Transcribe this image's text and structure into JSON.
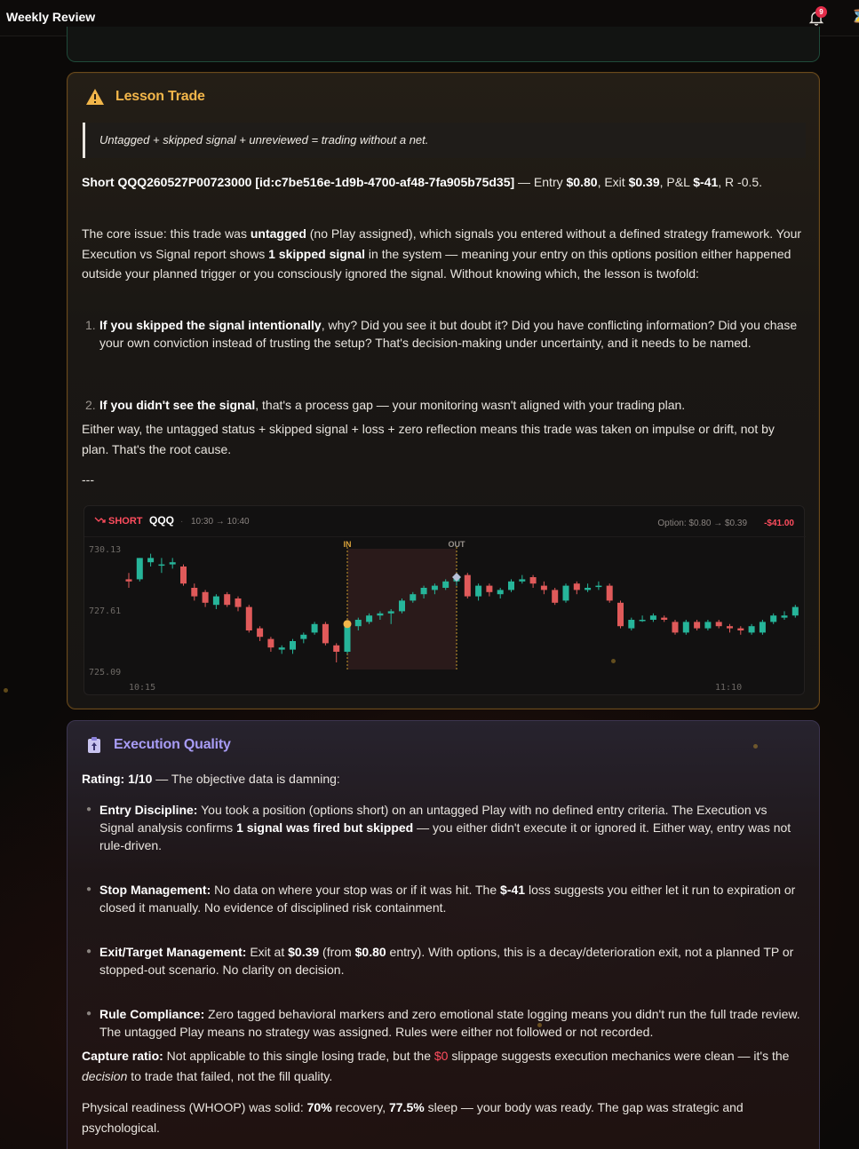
{
  "app": {
    "title": "Weekly Review",
    "notification_count": "9"
  },
  "lesson": {
    "title": "Lesson Trade",
    "quote": "Untagged + skipped signal + unreviewed = trading without a net.",
    "trade": {
      "label": "Short QQQ260527P00723000 [id:c7be516e-1d9b-4700-af48-7fa905b75d35]",
      "entry_prefix": " — Entry ",
      "entry": "$0.80",
      "exit_prefix": ", Exit ",
      "exit": "$0.39",
      "pnl_prefix": ", P&L ",
      "pnl": "$-41",
      "r_text": ", R -0.5."
    },
    "core_issue": {
      "t1": "The core issue: this trade was ",
      "b1": "untagged",
      "t2": " (no Play assigned), which signals you entered without a defined strategy framework. Your Execution vs Signal report shows ",
      "b2": "1 skipped signal",
      "t3": " in the system — meaning your entry on this options position either happened outside your planned trigger or you consciously ignored the signal. Without knowing which, the lesson is twofold:"
    },
    "items": [
      {
        "num": "1.",
        "bold": "If you skipped the signal intentionally",
        "text": ", why? Did you see it but doubt it? Did you have conflicting information? Did you chase your own conviction instead of trusting the setup? That's decision-making under uncertainty, and it needs to be named."
      },
      {
        "num": "2.",
        "bold": "If you didn't see the signal",
        "text": ", that's a process gap — your monitoring wasn't aligned with your trading plan."
      }
    ],
    "conclusion": "Either way, the untagged status + skipped signal + loss + zero reflection means this trade was taken on impulse or drift, not by plan. That's the root cause.",
    "separator": "---"
  },
  "chart_data": {
    "type": "candlestick",
    "direction": "SHORT",
    "symbol": "QQQ",
    "time_range": "10:30 → 10:40",
    "option_text": "Option: $0.80 → $0.39",
    "pnl_text": "-$41.00",
    "y_ticks": [
      "730.13",
      "727.61",
      "725.09"
    ],
    "ylim": [
      724.6,
      730.6
    ],
    "x_start_label": "10:15",
    "x_end_label": "11:10",
    "entry_label": "IN",
    "exit_label": "OUT",
    "entry_index": 20,
    "exit_index": 30,
    "candles": [
      {
        "o": 729.0,
        "c": 728.9,
        "h": 729.3,
        "l": 728.6
      },
      {
        "o": 729.0,
        "c": 730.0,
        "h": 730.0,
        "l": 728.9
      },
      {
        "o": 729.8,
        "c": 730.0,
        "h": 730.2,
        "l": 729.6
      },
      {
        "o": 729.7,
        "c": 729.7,
        "h": 730.0,
        "l": 729.3
      },
      {
        "o": 729.7,
        "c": 729.8,
        "h": 730.0,
        "l": 729.5
      },
      {
        "o": 729.6,
        "c": 728.8,
        "h": 729.7,
        "l": 728.7
      },
      {
        "o": 728.6,
        "c": 728.2,
        "h": 728.8,
        "l": 728.0
      },
      {
        "o": 728.4,
        "c": 727.9,
        "h": 728.5,
        "l": 727.7
      },
      {
        "o": 727.8,
        "c": 728.2,
        "h": 728.3,
        "l": 727.6
      },
      {
        "o": 728.3,
        "c": 727.8,
        "h": 728.4,
        "l": 727.7
      },
      {
        "o": 728.1,
        "c": 727.7,
        "h": 728.2,
        "l": 727.5
      },
      {
        "o": 727.7,
        "c": 726.6,
        "h": 727.8,
        "l": 726.5
      },
      {
        "o": 726.7,
        "c": 726.3,
        "h": 726.8,
        "l": 726.1
      },
      {
        "o": 726.2,
        "c": 725.8,
        "h": 726.3,
        "l": 725.6
      },
      {
        "o": 725.7,
        "c": 725.8,
        "h": 725.9,
        "l": 725.5
      },
      {
        "o": 725.7,
        "c": 726.1,
        "h": 726.2,
        "l": 725.5
      },
      {
        "o": 726.2,
        "c": 726.4,
        "h": 726.5,
        "l": 726.0
      },
      {
        "o": 726.5,
        "c": 726.9,
        "h": 727.0,
        "l": 726.4
      },
      {
        "o": 726.9,
        "c": 726.0,
        "h": 727.0,
        "l": 725.9
      },
      {
        "o": 725.9,
        "c": 725.6,
        "h": 726.0,
        "l": 725.1
      },
      {
        "o": 725.6,
        "c": 726.9,
        "h": 727.0,
        "l": 725.5
      },
      {
        "o": 726.8,
        "c": 727.1,
        "h": 727.2,
        "l": 726.6
      },
      {
        "o": 727.0,
        "c": 727.3,
        "h": 727.4,
        "l": 726.9
      },
      {
        "o": 727.3,
        "c": 727.4,
        "h": 727.5,
        "l": 727.1
      },
      {
        "o": 727.4,
        "c": 727.5,
        "h": 727.6,
        "l": 726.9
      },
      {
        "o": 727.5,
        "c": 728.0,
        "h": 728.1,
        "l": 727.4
      },
      {
        "o": 728.0,
        "c": 728.3,
        "h": 728.4,
        "l": 727.9
      },
      {
        "o": 728.3,
        "c": 728.6,
        "h": 728.7,
        "l": 728.1
      },
      {
        "o": 728.5,
        "c": 728.7,
        "h": 728.8,
        "l": 728.3
      },
      {
        "o": 728.6,
        "c": 728.9,
        "h": 729.0,
        "l": 728.5
      },
      {
        "o": 728.9,
        "c": 729.1,
        "h": 729.3,
        "l": 728.7
      },
      {
        "o": 729.2,
        "c": 728.2,
        "h": 729.3,
        "l": 728.1
      },
      {
        "o": 728.2,
        "c": 728.7,
        "h": 728.8,
        "l": 728.0
      },
      {
        "o": 728.7,
        "c": 728.4,
        "h": 728.8,
        "l": 728.2
      },
      {
        "o": 728.3,
        "c": 728.5,
        "h": 728.6,
        "l": 728.1
      },
      {
        "o": 728.5,
        "c": 728.9,
        "h": 729.0,
        "l": 728.4
      },
      {
        "o": 728.9,
        "c": 729.0,
        "h": 729.2,
        "l": 728.8
      },
      {
        "o": 729.1,
        "c": 728.8,
        "h": 729.2,
        "l": 728.6
      },
      {
        "o": 728.7,
        "c": 728.5,
        "h": 728.9,
        "l": 728.3
      },
      {
        "o": 728.5,
        "c": 727.9,
        "h": 728.6,
        "l": 727.8
      },
      {
        "o": 728.0,
        "c": 728.7,
        "h": 728.8,
        "l": 727.9
      },
      {
        "o": 728.8,
        "c": 728.5,
        "h": 728.9,
        "l": 728.3
      },
      {
        "o": 728.5,
        "c": 728.6,
        "h": 728.8,
        "l": 728.4
      },
      {
        "o": 728.7,
        "c": 728.7,
        "h": 728.9,
        "l": 728.5
      },
      {
        "o": 728.7,
        "c": 728.0,
        "h": 728.8,
        "l": 727.9
      },
      {
        "o": 727.9,
        "c": 726.8,
        "h": 728.0,
        "l": 726.7
      },
      {
        "o": 726.7,
        "c": 727.1,
        "h": 727.2,
        "l": 726.6
      },
      {
        "o": 727.1,
        "c": 727.1,
        "h": 727.3,
        "l": 727.0
      },
      {
        "o": 727.1,
        "c": 727.3,
        "h": 727.4,
        "l": 727.0
      },
      {
        "o": 727.2,
        "c": 727.1,
        "h": 727.3,
        "l": 727.0
      },
      {
        "o": 727.0,
        "c": 726.5,
        "h": 727.1,
        "l": 726.4
      },
      {
        "o": 726.5,
        "c": 727.0,
        "h": 727.1,
        "l": 726.4
      },
      {
        "o": 727.0,
        "c": 726.7,
        "h": 727.1,
        "l": 726.6
      },
      {
        "o": 726.7,
        "c": 727.0,
        "h": 727.1,
        "l": 726.6
      },
      {
        "o": 727.0,
        "c": 726.8,
        "h": 727.1,
        "l": 726.7
      },
      {
        "o": 726.8,
        "c": 726.7,
        "h": 726.9,
        "l": 726.5
      },
      {
        "o": 726.7,
        "c": 726.6,
        "h": 726.8,
        "l": 726.4
      },
      {
        "o": 726.5,
        "c": 726.8,
        "h": 726.9,
        "l": 726.4
      },
      {
        "o": 726.5,
        "c": 727.0,
        "h": 727.1,
        "l": 726.4
      },
      {
        "o": 727.0,
        "c": 727.3,
        "h": 727.4,
        "l": 726.9
      },
      {
        "o": 727.2,
        "c": 727.3,
        "h": 727.5,
        "l": 727.1
      },
      {
        "o": 727.3,
        "c": 727.7,
        "h": 727.8,
        "l": 727.2
      }
    ]
  },
  "execution": {
    "title": "Execution Quality",
    "rating_label": "Rating: 1/10",
    "rating_text": " — The objective data is damning:",
    "items": [
      {
        "bold": "Entry Discipline:",
        "t1": " You took a position (options short) on an untagged Play with no defined entry criteria. The Execution vs Signal analysis confirms ",
        "b2": "1 signal was fired but skipped",
        "t2": " — you either didn't execute it or ignored it. Either way, entry was not rule-driven."
      },
      {
        "bold": "Stop Management:",
        "t1": " No data on where your stop was or if it was hit. The ",
        "b2": "$-41",
        "t2": " loss suggests you either let it run to expiration or closed it manually. No evidence of disciplined risk containment."
      },
      {
        "bold": "Exit/Target Management:",
        "t1": " Exit at ",
        "b2": "$0.39",
        "t2": " (from ",
        "b3": "$0.80",
        "t3": " entry). With options, this is a decay/deterioration exit, not a planned TP or stopped-out scenario. No clarity on decision."
      },
      {
        "bold": "Rule Compliance:",
        "t1": " Zero tagged behavioral markers and zero emotional state logging means you didn't run the full trade review. The untagged Play means no strategy was assigned. Rules were either not followed or not recorded."
      }
    ],
    "capture": {
      "label": "Capture ratio:",
      "t1": " Not applicable to this single losing trade, but the ",
      "red": "$0",
      "t2": " slippage suggests execution mechanics were clean — it's the ",
      "em": "decision",
      "t3": " to trade that failed, not the fill quality."
    },
    "physical": {
      "t1": "Physical readiness (WHOOP) was solid: ",
      "b1": "70%",
      "t2": " recovery, ",
      "b2": "77.5%",
      "t3": " sleep — your body was ready. The gap was strategic and psychological."
    }
  },
  "colors": {
    "bull": "#26b59a",
    "bear": "#e05a5a",
    "lesson_accent": "#f2b64a",
    "exec_accent": "#a89cf5",
    "loss": "#ff4d5e"
  }
}
